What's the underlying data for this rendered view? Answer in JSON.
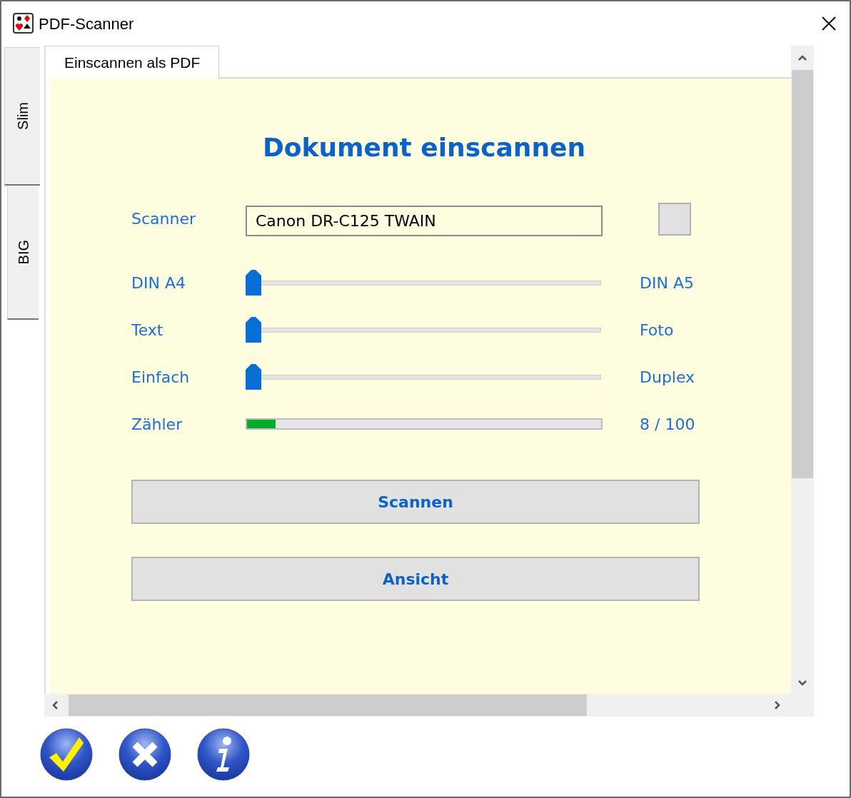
{
  "window": {
    "title": "PDF-Scanner"
  },
  "side_tabs": [
    {
      "label": "Slim",
      "selected": true
    },
    {
      "label": "BIG",
      "selected": false
    }
  ],
  "tabs": [
    {
      "label": "Einscannen als PDF",
      "selected": true
    }
  ],
  "heading": "Dokument einscannen",
  "scanner": {
    "label": "Scanner",
    "value": "Canon DR-C125 TWAIN"
  },
  "settings": [
    {
      "kind": "slider",
      "label": "DIN A4",
      "level": 0,
      "end_label": "DIN A5"
    },
    {
      "kind": "slider",
      "label": "Text",
      "level": 0,
      "end_label": "Foto"
    },
    {
      "kind": "slider",
      "label": "Einfach",
      "level": 0,
      "end_label": "Duplex"
    },
    {
      "kind": "progress",
      "label": "Zähler",
      "level": 0.08,
      "end_label": "8 / 100"
    }
  ],
  "buttons": [
    "Scannen",
    "Ansicht"
  ]
}
